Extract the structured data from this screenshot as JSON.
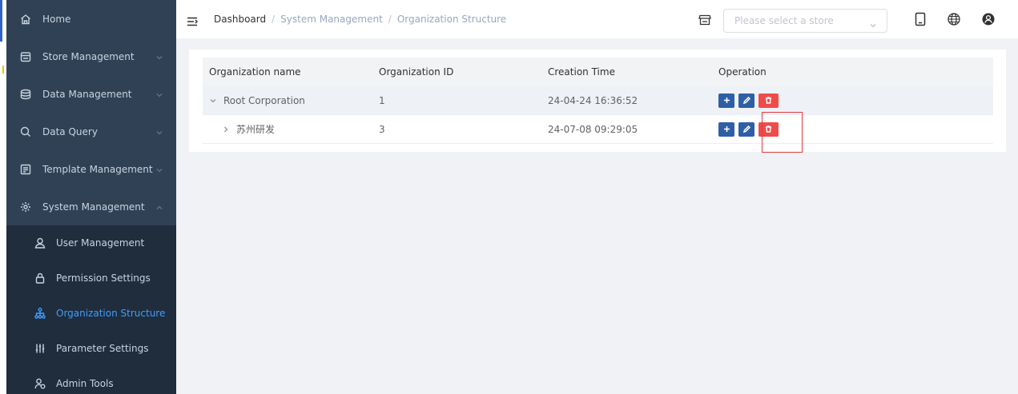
{
  "sidebar": {
    "items": [
      {
        "label": "Home",
        "icon": "home-icon",
        "has_arrow": false
      },
      {
        "label": "Store Management",
        "icon": "store-icon",
        "has_arrow": true
      },
      {
        "label": "Data Management",
        "icon": "database-icon",
        "has_arrow": true
      },
      {
        "label": "Data Query",
        "icon": "search-icon",
        "has_arrow": true
      },
      {
        "label": "Template Management",
        "icon": "template-icon",
        "has_arrow": true
      },
      {
        "label": "System Management",
        "icon": "gear-icon",
        "has_arrow": true,
        "expanded": true
      }
    ],
    "subitems": [
      {
        "label": "User Management",
        "icon": "user-icon"
      },
      {
        "label": "Permission Settings",
        "icon": "lock-icon"
      },
      {
        "label": "Organization Structure",
        "icon": "org-chart-icon",
        "active": true
      },
      {
        "label": "Parameter Settings",
        "icon": "sliders-icon"
      },
      {
        "label": "Admin Tools",
        "icon": "admin-tools-icon"
      }
    ]
  },
  "header": {
    "breadcrumb": [
      "Dashboard",
      "System Management",
      "Organization Structure"
    ],
    "breadcrumb_separator": "/",
    "store_select_placeholder": "Please select a store",
    "icons": [
      "store-icon",
      "tablet-icon",
      "globe-icon",
      "user-avatar-icon"
    ]
  },
  "table": {
    "columns": [
      "Organization name",
      "Organization ID",
      "Creation Time",
      "Operation"
    ],
    "rows": [
      {
        "name": "Root Corporation",
        "id": "1",
        "created": "24-04-24 16:36:52",
        "expanded": true
      },
      {
        "name": "苏州研发",
        "id": "3",
        "created": "24-07-08 09:29:05",
        "expanded": false
      }
    ],
    "operations": [
      "add-icon",
      "edit-icon",
      "delete-icon"
    ]
  },
  "colors": {
    "sidebar_bg": "#304156",
    "submenu_bg": "#1f2d3d",
    "active_text": "#409eff",
    "btn_blue": "#2e5fa6",
    "btn_red": "#f04b4b",
    "highlight_border": "#e23a3a"
  }
}
